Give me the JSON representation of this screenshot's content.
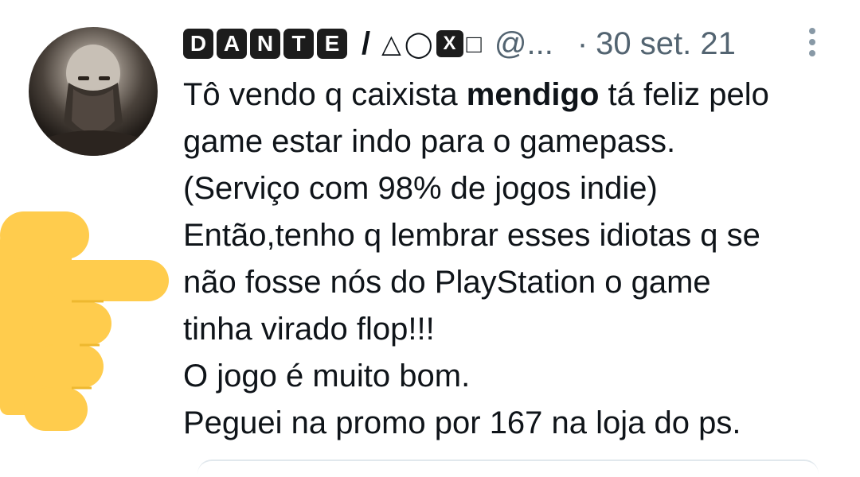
{
  "author": {
    "name_letters": [
      "D",
      "A",
      "N",
      "T",
      "E"
    ],
    "separator": "/",
    "symbols": {
      "triangle": "△",
      "circle": "◯",
      "cross": "X",
      "square": "□"
    },
    "handle": "@...",
    "dot": "·",
    "date": "30 set. 21"
  },
  "tweet": {
    "line1_pre": "Tô vendo q caixista ",
    "line1_bold": "mendigo",
    "line1_post": " tá feliz pelo",
    "line2": "game estar indo para o gamepass.",
    "line3": "(Serviço com 98% de jogos indie)",
    "line4": "Então,tenho q lembrar esses idiotas q se",
    "line5": "não fosse nós do PlayStation o game",
    "line6": "tinha virado flop!!!",
    "line7": "O jogo é muito bom.",
    "line8": "Peguei na promo por 167 na loja do ps."
  },
  "icons": {
    "avatar": "bearded-warrior-avatar",
    "more": "more-options-icon",
    "emoji": "pointing-right-hand-emoji"
  },
  "colors": {
    "text": "#0f1419",
    "muted": "#536471",
    "emoji": "#ffcc4d"
  }
}
